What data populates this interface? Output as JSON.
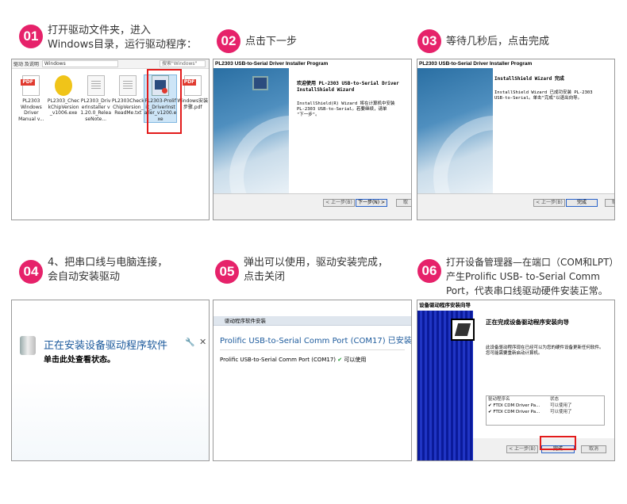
{
  "accent_color": "#e6226a",
  "steps": [
    {
      "num": "01",
      "lines": [
        "打开驱动文件夹，进入",
        "Windows目录，运行驱动程序："
      ]
    },
    {
      "num": "02",
      "lines": [
        "点击下一步"
      ]
    },
    {
      "num": "03",
      "lines": [
        "等待几秒后，点击完成"
      ]
    },
    {
      "num": "04",
      "lines": [
        "4、把串口线与电脑连接，",
        "会自动安装驱动"
      ]
    },
    {
      "num": "05",
      "lines": [
        "弹出可以使用，驱动安装完成，",
        "点击关闭"
      ]
    },
    {
      "num": "06",
      "lines": [
        "打开设备管理器—在端口（COM和LPT）",
        "产生Prolific USB- to-Serial Comm",
        "Port，代表串口线驱动硬件安装正常。"
      ]
    }
  ],
  "shot1": {
    "path_a": "驱动 及说明",
    "path_b": "Windows",
    "search": "搜索\"Windows\"",
    "files": [
      {
        "icon": "pdf-icon",
        "name": "PL2303 Windows Driver Manual v..."
      },
      {
        "icon": "chip-icon",
        "name": "PL2303_CheckChipVersion_v1006.exe"
      },
      {
        "icon": "txt-icon",
        "name": "PL2303_DriverInstaller v1.20.0_ReleaseNote..."
      },
      {
        "icon": "txt-icon",
        "name": "PL2303CheckChipVersion_ReadMe.txt"
      },
      {
        "icon": "exe-icon",
        "name": "PL2303-Prolific_DriverInstaller_v1200.exe"
      },
      {
        "icon": "pdf-icon",
        "name": "Windows安装步骤.pdf"
      }
    ]
  },
  "shot2": {
    "title": "PL2303 USB-to-Serial Driver Installer Program",
    "heading1": "欢迎使用 PL-2303 USB-to-Serial Driver",
    "heading2": "InstallShield Wizard",
    "para1": "InstallShield(R) Wizard 将在计算机中安装",
    "para2": "PL-2303 USB-to-Serial。若要继续，请单",
    "para3": "\"下一步\"。",
    "back": "< 上一步(B)",
    "next": "下一步(N) >",
    "cancel": "取"
  },
  "shot3": {
    "title": "PL2303 USB-to-Serial Driver Installer Program",
    "heading": "InstallShield Wizard 完成",
    "para1": "InstallShield Wizard 已成功安装 PL-2303",
    "para2": "USB-to-Serial。单击\"完成\"以退出向导。",
    "back": "< 上一步(B)",
    "finish": "完成",
    "cancel": "取"
  },
  "shot4": {
    "title": "正在安装设备驱动程序软件",
    "subtitle": "单击此处查看状态。"
  },
  "shot5": {
    "bar": "驱动程序软件安装",
    "title": "Prolific USB-to-Serial Comm Port (COM17) 已安装",
    "row": "Prolific USB-to-Serial Comm Port (COM17)",
    "status": "可以使用"
  },
  "shot6": {
    "title": "设备驱动程序安装向导",
    "heading": "正在完成设备驱动程序安装向导",
    "para": "此设备驱动程序现在已经可以为您的硬件设备更新任何软件。您可能需要重新启动计算机。",
    "col1": "驱动程序名",
    "col2": "状态",
    "rows": [
      {
        "name": "✔ FTDI CDM Driver Pa...",
        "status": "可以使用了"
      },
      {
        "name": "✔ FTDI CDM Driver Pa...",
        "status": "可以使用了"
      }
    ],
    "back": "< 上一步(B)",
    "finish": "完成",
    "cancel": "取消"
  }
}
